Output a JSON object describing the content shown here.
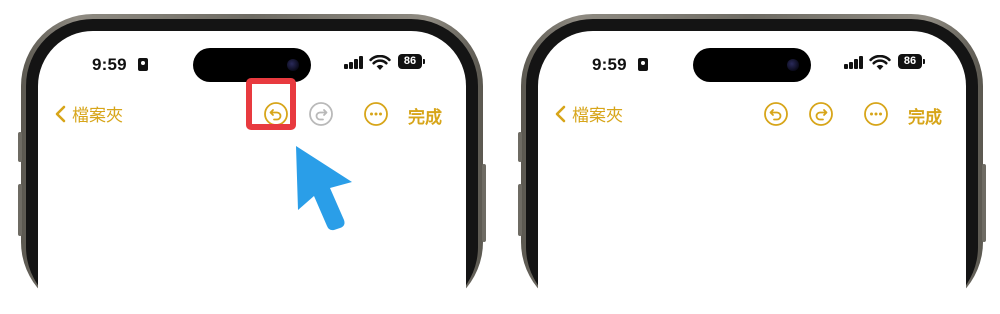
{
  "colors": {
    "accent": "#d7a519",
    "disabled": "#b9b9b9",
    "highlight": "#e83a3f",
    "cursor": "#2a9ee8"
  },
  "left_phone": {
    "status_bar": {
      "time": "9:59",
      "battery": "86"
    },
    "nav": {
      "back_label": "檔案夾",
      "undo_icon": "undo-icon",
      "redo_icon": "redo-icon",
      "redo_enabled": false,
      "more_icon": "ellipsis-circle-icon",
      "done_label": "完成"
    },
    "annotation": {
      "highlight": "undo-button",
      "pointer": "cursor-arrow"
    }
  },
  "right_phone": {
    "status_bar": {
      "time": "9:59",
      "battery": "86"
    },
    "nav": {
      "back_label": "檔案夾",
      "undo_icon": "undo-icon",
      "redo_icon": "redo-icon",
      "redo_enabled": true,
      "more_icon": "ellipsis-circle-icon",
      "done_label": "完成"
    }
  }
}
